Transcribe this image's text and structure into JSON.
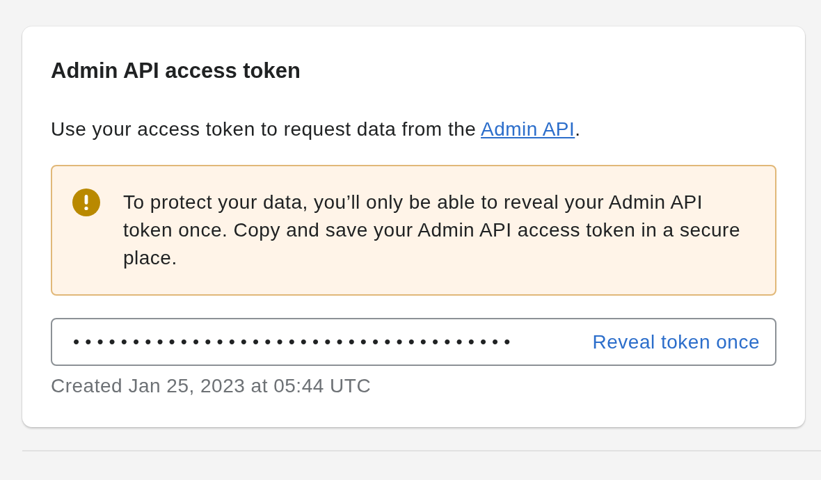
{
  "card": {
    "title": "Admin API access token",
    "description": {
      "text": "Use your access token to request data from the ",
      "link": "Admin API",
      "after": "."
    },
    "banner": {
      "kind": "warning",
      "message": "To protect your data, you’ll only be able to reveal your Admin API token once. Copy and save your Admin API access token in a secure place."
    },
    "token_field": {
      "value": "•••••••••••••••••••••••••••••••••••••",
      "action": "Reveal token once"
    },
    "created": "Created Jan 25, 2023 at 05:44 UTC"
  }
}
